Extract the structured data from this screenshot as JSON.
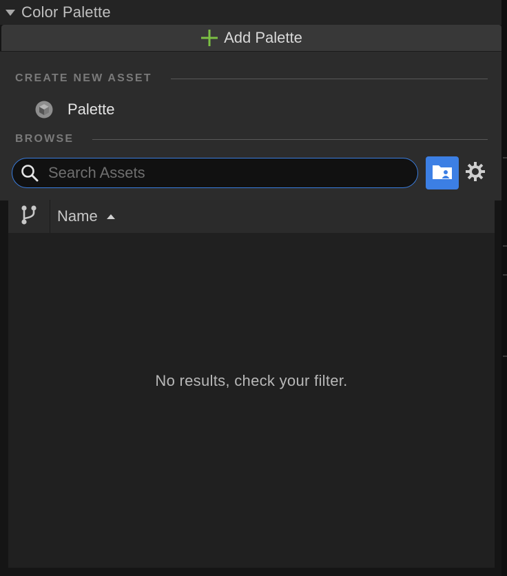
{
  "section": {
    "title": "Color Palette",
    "caret_icon": "caret-down-icon"
  },
  "add_button": {
    "label": "Add Palette",
    "icon": "plus-icon",
    "icon_color": "#7bc043"
  },
  "menu": {
    "create_heading": "CREATE NEW ASSET",
    "items": [
      {
        "label": "Palette",
        "icon": "palette-asset-icon"
      }
    ],
    "browse_heading": "BROWSE",
    "search": {
      "placeholder": "Search Assets",
      "value": ""
    },
    "folder_icon": "folder-user-icon",
    "settings_icon": "gear-icon"
  },
  "table": {
    "columns": [
      {
        "label": "Name",
        "sort": "ascending"
      }
    ],
    "branch_icon": "branch-icon",
    "empty_message": "No results, check your filter."
  },
  "colors": {
    "accent": "#3c7fe4",
    "add_green": "#7bc043"
  }
}
